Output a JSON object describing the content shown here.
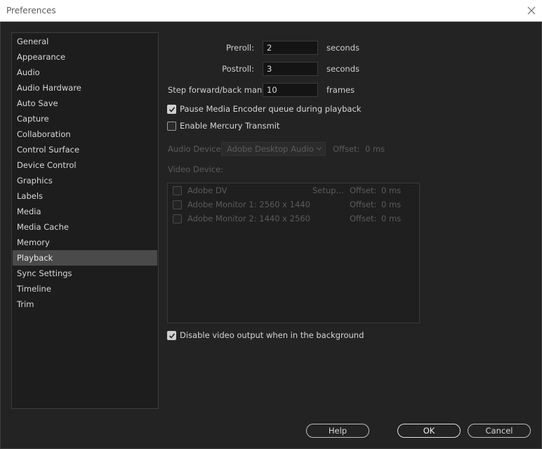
{
  "window": {
    "title": "Preferences"
  },
  "sidebar": {
    "items": [
      {
        "label": "General"
      },
      {
        "label": "Appearance"
      },
      {
        "label": "Audio"
      },
      {
        "label": "Audio Hardware"
      },
      {
        "label": "Auto Save"
      },
      {
        "label": "Capture"
      },
      {
        "label": "Collaboration"
      },
      {
        "label": "Control Surface"
      },
      {
        "label": "Device Control"
      },
      {
        "label": "Graphics"
      },
      {
        "label": "Labels"
      },
      {
        "label": "Media"
      },
      {
        "label": "Media Cache"
      },
      {
        "label": "Memory"
      },
      {
        "label": "Playback",
        "selected": true
      },
      {
        "label": "Sync Settings"
      },
      {
        "label": "Timeline"
      },
      {
        "label": "Trim"
      }
    ]
  },
  "playback": {
    "preroll": {
      "label": "Preroll:",
      "value": "2",
      "unit": "seconds"
    },
    "postroll": {
      "label": "Postroll:",
      "value": "3",
      "unit": "seconds"
    },
    "step": {
      "label": "Step forward/back many:",
      "value": "10",
      "unit": "frames"
    },
    "pause_encoder": {
      "label": "Pause Media Encoder queue during playback",
      "checked": true
    },
    "mercury": {
      "label": "Enable Mercury Transmit",
      "checked": false
    },
    "audio_device": {
      "label": "Audio Device:",
      "value": "Adobe Desktop Audio",
      "offset_label": "Offset:",
      "offset_value": "0 ms"
    },
    "video_device": {
      "label": "Video Device:",
      "devices": [
        {
          "name": "Adobe DV",
          "setup": "Setup...",
          "offset_label": "Offset:",
          "offset_value": "0 ms"
        },
        {
          "name": "Adobe Monitor 1: 2560 x 1440",
          "offset_label": "Offset:",
          "offset_value": "0 ms"
        },
        {
          "name": "Adobe Monitor 2: 1440 x 2560",
          "offset_label": "Offset:",
          "offset_value": "0 ms"
        }
      ]
    },
    "disable_bg": {
      "label": "Disable video output when in the background",
      "checked": true
    }
  },
  "buttons": {
    "help": "Help",
    "ok": "OK",
    "cancel": "Cancel"
  }
}
